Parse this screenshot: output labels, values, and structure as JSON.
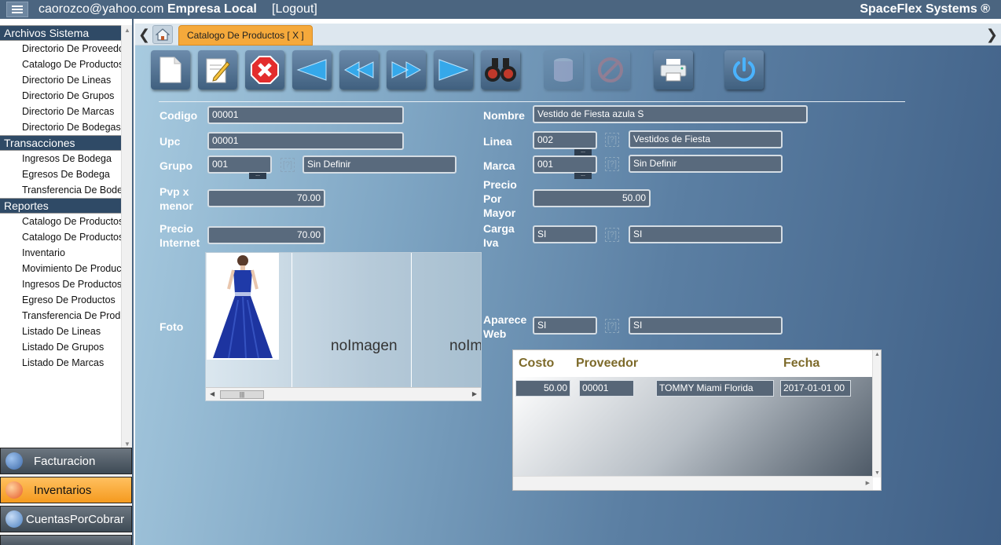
{
  "topbar": {
    "user_email": "caorozco@yahoo.com",
    "company": "Empresa Local",
    "logout": "[Logout]",
    "brand": "SpaceFlex Systems ®"
  },
  "sidebar": {
    "sections": [
      {
        "title": "Archivos Sistema",
        "items": [
          "Directorio De Proveedores",
          "Catalogo De Productos",
          "Directorio De Lineas",
          "Directorio De Grupos",
          "Directorio De Marcas",
          "Directorio De Bodegas"
        ]
      },
      {
        "title": "Transacciones",
        "items": [
          "Ingresos De Bodega",
          "Egresos De Bodega",
          "Transferencia De Bodega"
        ]
      },
      {
        "title": "Reportes",
        "items": [
          "Catalogo De Productos",
          "Catalogo De Productos",
          "Inventario",
          "Movimiento De Productos",
          "Ingresos De Productos",
          "Egreso De Productos",
          "Transferencia De Productos",
          "Listado De Lineas",
          "Listado De Grupos",
          "Listado De Marcas"
        ]
      }
    ],
    "modules": [
      {
        "label": "Facturacion",
        "icon": "billing-icon",
        "color": "#3d6aa8"
      },
      {
        "label": "Inventarios",
        "icon": "inventory-icon",
        "color": "#e65a2a"
      },
      {
        "label": "CuentasPorCobrar",
        "icon": "receivables-icon",
        "color": "#4a7fc0"
      }
    ]
  },
  "tabs": {
    "home_icon": "home-icon",
    "active_tab": "Catalogo De Productos [ X ]"
  },
  "toolbar": [
    {
      "name": "new",
      "icon": "new-document-icon",
      "enabled": true
    },
    {
      "name": "edit",
      "icon": "edit-icon",
      "enabled": true
    },
    {
      "name": "delete",
      "icon": "delete-icon",
      "enabled": true
    },
    {
      "name": "first",
      "icon": "first-record-icon",
      "enabled": true
    },
    {
      "name": "previous",
      "icon": "previous-record-icon",
      "enabled": true
    },
    {
      "name": "next",
      "icon": "next-record-icon",
      "enabled": true
    },
    {
      "name": "last",
      "icon": "last-record-icon",
      "enabled": true
    },
    {
      "name": "search",
      "icon": "binoculars-icon",
      "enabled": true
    },
    {
      "name": "save",
      "icon": "database-icon",
      "enabled": false
    },
    {
      "name": "cancel",
      "icon": "cancel-icon",
      "enabled": false
    },
    {
      "name": "print",
      "icon": "printer-icon",
      "enabled": true
    },
    {
      "name": "exit",
      "icon": "power-icon",
      "enabled": true
    }
  ],
  "form": {
    "codigo": {
      "label": "Codigo",
      "value": "00001"
    },
    "upc": {
      "label": "Upc",
      "value": "00001"
    },
    "grupo": {
      "label": "Grupo",
      "code": "001",
      "help": "[?]",
      "desc": "Sin Definir"
    },
    "pvp_menor": {
      "label1": "Pvp x",
      "label2": "menor",
      "value": "70.00"
    },
    "precio_internet": {
      "label1": "Precio",
      "label2": "Internet",
      "value": "70.00"
    },
    "foto": {
      "label": "Foto",
      "no_image": "noImagen"
    },
    "nombre": {
      "label": "Nombre",
      "value": "Vestido de Fiesta azula S"
    },
    "linea": {
      "label": "Linea",
      "code": "002",
      "help": "[?]",
      "desc": "Vestidos de Fiesta"
    },
    "marca": {
      "label": "Marca",
      "code": "001",
      "help": "[?]",
      "desc": "Sin Definir"
    },
    "precio_mayor": {
      "label1": "Precio",
      "label2": "Por",
      "label3": "Mayor",
      "value": "50.00"
    },
    "carga_iva": {
      "label1": "Carga",
      "label2": "Iva",
      "code": "SI",
      "help": "[?]",
      "desc": "SI"
    },
    "aparece_web": {
      "label1": "Aparece",
      "label2": "Web",
      "code": "SI",
      "help": "[?]",
      "desc": "SI"
    },
    "dots": "..."
  },
  "grid": {
    "headers": [
      "Costo",
      "Proveedor",
      "Fecha"
    ],
    "rows": [
      {
        "costo": "50.00",
        "proveedor": "00001",
        "nombre": "TOMMY Miami Florida",
        "fecha": "2017-01-01 00"
      }
    ]
  }
}
